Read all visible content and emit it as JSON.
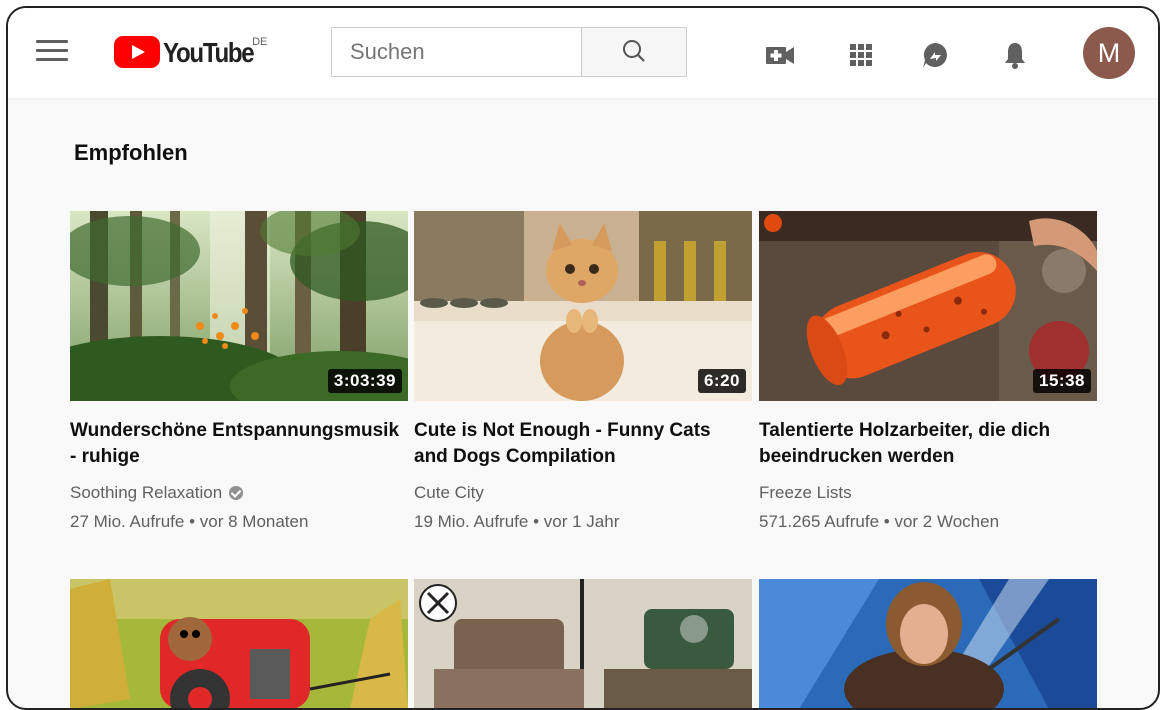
{
  "header": {
    "menu_icon": "hamburger-menu-icon",
    "logo_text": "YouTube",
    "logo_region": "DE",
    "search_placeholder": "Suchen",
    "icons": [
      "video-camera-plus-icon",
      "apps-grid-icon",
      "messages-icon",
      "bell-icon"
    ],
    "avatar_letter": "M",
    "avatar_color": "#8c5a4c"
  },
  "main": {
    "section_title": "Empfohlen",
    "videos": [
      {
        "title": "Wunderschöne Entspannungsmusik - ruhige",
        "channel": "Soothing Relaxation",
        "verified": true,
        "views": "27 Mio. Aufrufe",
        "age": "vor 8 Monaten",
        "duration": "3:03:39",
        "thumbnail": "forest-thumbnail"
      },
      {
        "title": "Cute is Not Enough - Funny Cats and Dogs Compilation",
        "channel": "Cute City",
        "verified": false,
        "views": "19 Mio. Aufrufe",
        "age": "vor 1 Jahr",
        "duration": "6:20",
        "thumbnail": "kitten-thumbnail"
      },
      {
        "title": "Talentierte Holzarbeiter, die dich beeindrucken werden",
        "channel": "Freeze Lists",
        "verified": false,
        "views": "571.265 Aufrufe",
        "age": "vor 2 Wochen",
        "duration": "15:38",
        "thumbnail": "resin-wood-thumbnail"
      }
    ],
    "second_row_thumbnails": [
      "cartoon-tractor-thumbnail",
      "vise-workshop-thumbnail",
      "talent-show-thumbnail"
    ],
    "meta_separator": "•"
  },
  "colors": {
    "brand_red": "#ff0000",
    "text_primary": "#0f0f0f",
    "text_secondary": "#606060",
    "background": "#f9f9f9"
  }
}
